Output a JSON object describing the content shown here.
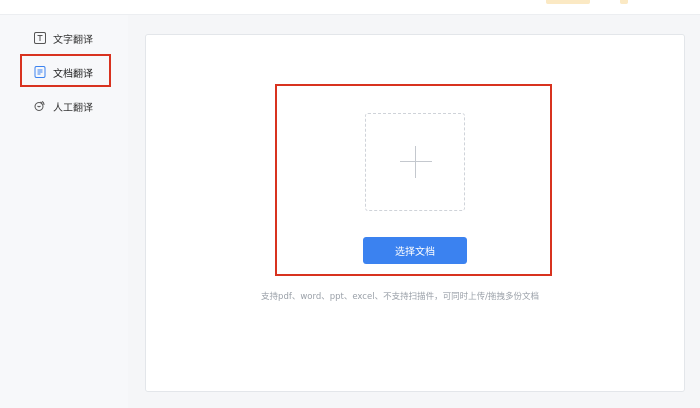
{
  "colors": {
    "accent": "#3b82f0",
    "highlight": "#d8321f"
  },
  "sidebar": {
    "items": [
      {
        "label": "文字翻译",
        "icon": "text-t-icon",
        "active": false
      },
      {
        "label": "文档翻译",
        "icon": "document-icon",
        "active": true
      },
      {
        "label": "人工翻译",
        "icon": "person-speech-icon",
        "active": false
      }
    ]
  },
  "upload": {
    "button_label": "选择文档",
    "hint": "支持pdf、word、ppt、excel、不支持扫描件，可同时上传/拖拽多份文档"
  }
}
